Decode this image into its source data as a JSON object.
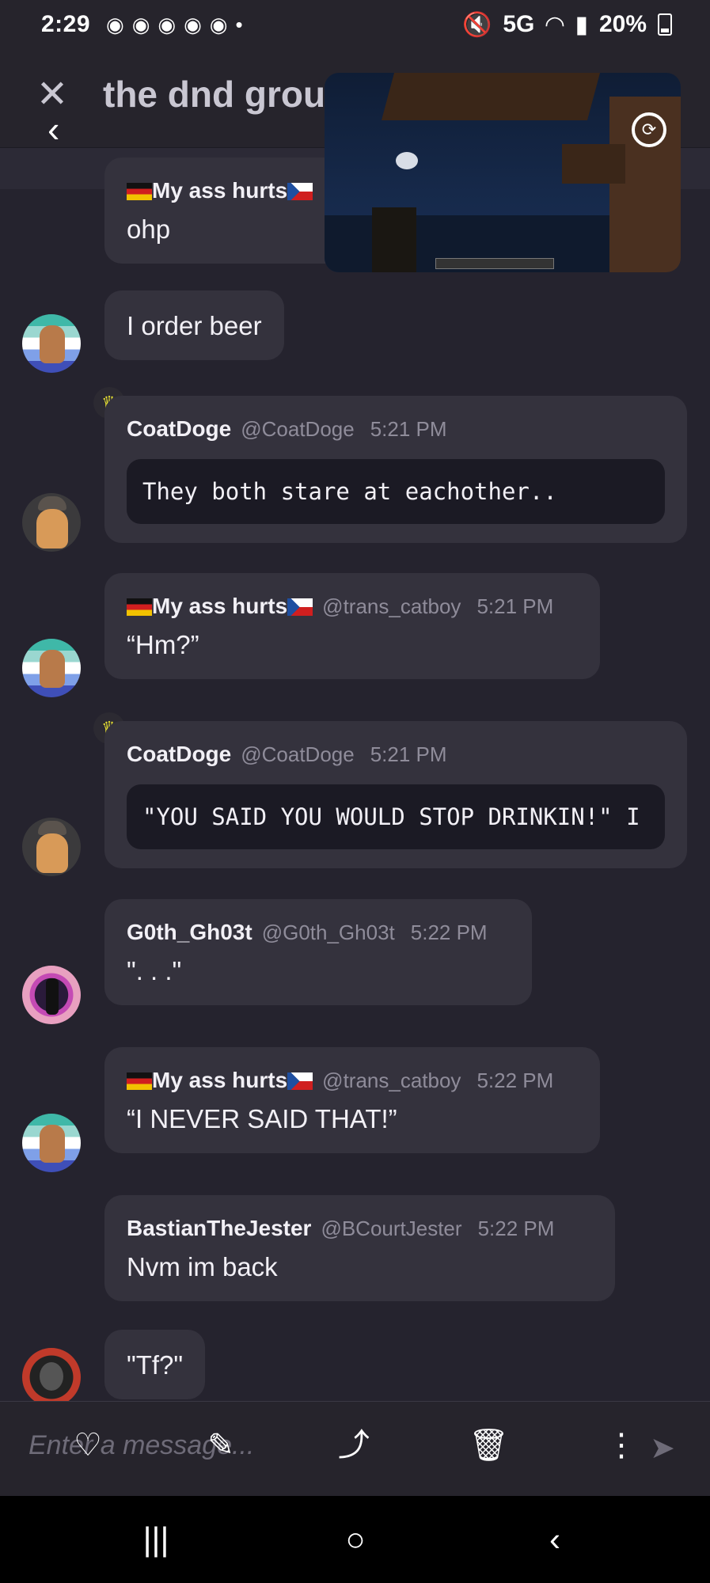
{
  "status_bar": {
    "time": "2:29",
    "notification_icons": [
      "discord-icon",
      "discord-icon",
      "discord-icon",
      "discord-icon",
      "discord-icon"
    ],
    "dot": "•",
    "network": "5G",
    "battery": "20%"
  },
  "header": {
    "title": "the dnd group",
    "close_icon": "✕",
    "back_icon": "‹"
  },
  "pip": {
    "rotate_icon": "⟳"
  },
  "messages": [
    {
      "name": "My ass hurts",
      "handle": "",
      "time": "",
      "text": "ohp",
      "is_code": false
    },
    {
      "name": "",
      "handle": "",
      "time": "",
      "text": "I order beer",
      "is_code": false
    },
    {
      "name": "CoatDoge",
      "handle": "@CoatDoge",
      "time": "5:21 PM",
      "text": "They both stare at eachother..",
      "is_code": true
    },
    {
      "name": "My ass hurts",
      "handle": "@trans_catboy",
      "time": "5:21 PM",
      "text": "“Hm?”",
      "is_code": false
    },
    {
      "name": "CoatDoge",
      "handle": "@CoatDoge",
      "time": "5:21 PM",
      "text": "\"YOU SAID YOU WOULD STOP DRINKIN!\" I",
      "is_code": true
    },
    {
      "name": "G0th_Gh03t",
      "handle": "@G0th_Gh03t",
      "time": "5:22 PM",
      "text": "\". . .\"",
      "is_code": false
    },
    {
      "name": "My ass hurts",
      "handle": "@trans_catboy",
      "time": "5:22 PM",
      "text": "“I NEVER SAID THAT!”",
      "is_code": false
    },
    {
      "name": "BastianTheJester",
      "handle": "@BCourtJester",
      "time": "5:22 PM",
      "text": "Nvm im back",
      "is_code": false
    },
    {
      "name": "",
      "handle": "",
      "time": "",
      "text": "\"Tf?\"",
      "is_code": false
    }
  ],
  "composer": {
    "placeholder": "Enter a message...",
    "send_icon": "➤"
  },
  "actions": {
    "like_icon": "♡",
    "edit_icon": "✎",
    "share_icon": "⤴",
    "delete_icon": "🗑",
    "more_icon": "⋮"
  },
  "navbar": {
    "recents_icon": "|||",
    "home_icon": "○",
    "back_icon": "‹"
  }
}
